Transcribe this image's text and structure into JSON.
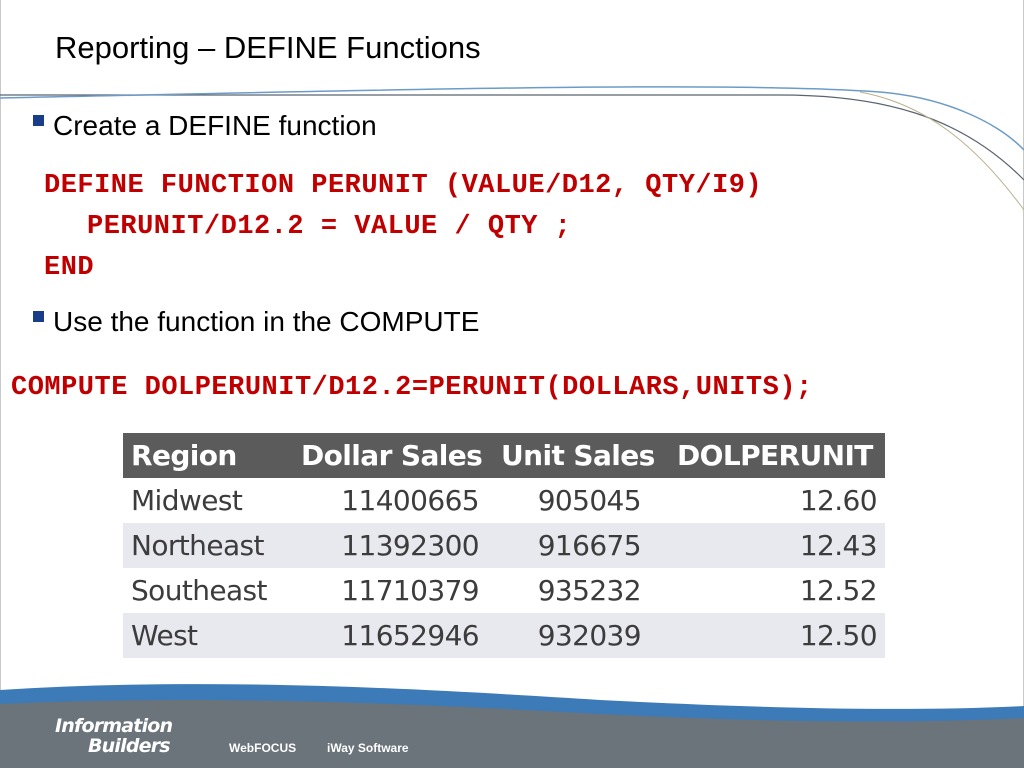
{
  "slide": {
    "title": "Reporting – DEFINE Functions",
    "bullets": [
      {
        "text": "Create a DEFINE function"
      },
      {
        "text": "Use the function in the COMPUTE"
      }
    ],
    "code_define": [
      "DEFINE FUNCTION PERUNIT (VALUE/D12, QTY/I9)",
      "PERUNIT/D12.2 = VALUE / QTY ;",
      "END"
    ],
    "code_compute": "COMPUTE DOLPERUNIT/D12.2=PERUNIT(DOLLARS,UNITS);",
    "colors": {
      "code": "#c00000",
      "bullet": "#1a3d8a",
      "table_header": "#5b5b5b",
      "table_alt_row": "#e8e9ef",
      "footer_band": "#6b737b",
      "swoosh_blue": "#3c7bb8"
    }
  },
  "table": {
    "headers": [
      "Region",
      "Dollar Sales",
      "Unit Sales",
      "DOLPERUNIT"
    ],
    "rows": [
      [
        "Midwest",
        "11400665",
        "905045",
        "12.60"
      ],
      [
        "Northeast",
        "11392300",
        "916675",
        "12.43"
      ],
      [
        "Southeast",
        "11710379",
        "935232",
        "12.52"
      ],
      [
        "West",
        "11652946",
        "932039",
        "12.50"
      ]
    ]
  },
  "footer": {
    "logo_line1": "Information",
    "logo_line2": "Builders",
    "links": [
      "WebFOCUS",
      "iWay Software"
    ]
  }
}
